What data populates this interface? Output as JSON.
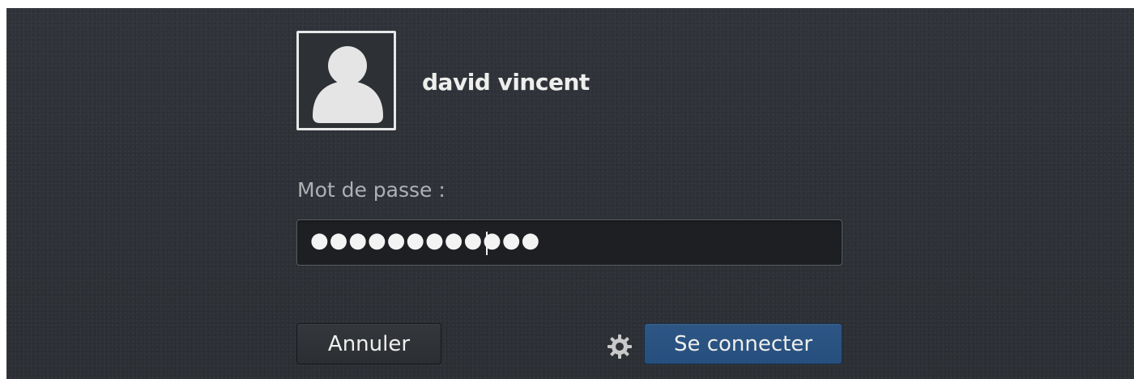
{
  "login": {
    "username": "david vincent",
    "password_label": "Mot de passe :",
    "password_value": "●●●●●●●●●●●●",
    "buttons": {
      "cancel_label": "Annuler",
      "connect_label": "Se connecter"
    },
    "icons": {
      "avatar": "user-avatar-icon",
      "settings": "gear-icon"
    },
    "colors": {
      "background": "#2c3035",
      "text": "#eeeeec",
      "input_background": "#1d1f22",
      "primary_button": "#2a5180"
    }
  }
}
